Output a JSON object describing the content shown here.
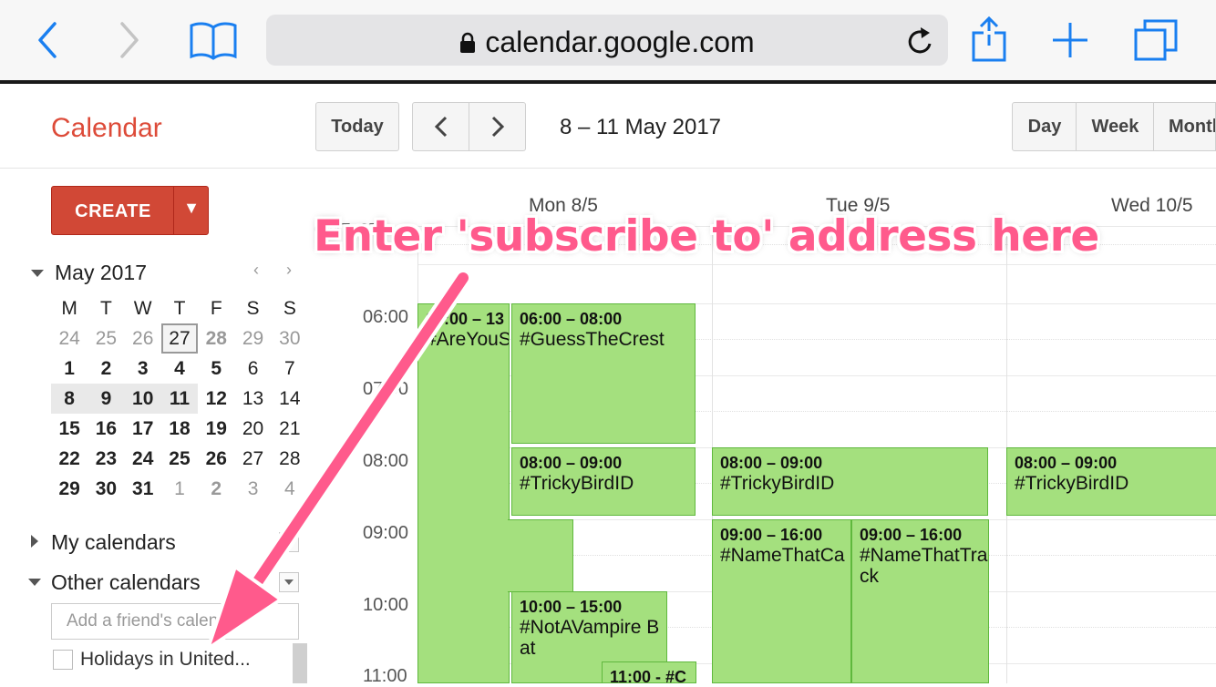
{
  "browser": {
    "url": "calendar.google.com",
    "icons": [
      "back-icon",
      "forward-icon",
      "bookmarks-icon",
      "lock-icon",
      "reload-icon",
      "share-icon",
      "new-tab-icon",
      "tabs-icon"
    ]
  },
  "header": {
    "app_title": "Calendar",
    "today_label": "Today",
    "date_range": "8 – 11 May 2017",
    "views": [
      "Day",
      "Week",
      "Month"
    ]
  },
  "sidebar": {
    "create_label": "CREATE",
    "mini_calendar": {
      "month": "May 2017",
      "weekdays": [
        "M",
        "T",
        "W",
        "T",
        "F",
        "S",
        "S"
      ],
      "weeks": [
        [
          "24",
          "25",
          "26",
          "27",
          "28",
          "29",
          "30"
        ],
        [
          "1",
          "2",
          "3",
          "4",
          "5",
          "6",
          "7"
        ],
        [
          "8",
          "9",
          "10",
          "11",
          "12",
          "13",
          "14"
        ],
        [
          "15",
          "16",
          "17",
          "18",
          "19",
          "20",
          "21"
        ],
        [
          "22",
          "23",
          "24",
          "25",
          "26",
          "27",
          "28"
        ],
        [
          "29",
          "30",
          "31",
          "1",
          "2",
          "3",
          "4"
        ]
      ]
    },
    "my_calendars_label": "My calendars",
    "other_calendars_label": "Other calendars",
    "friend_placeholder": "Add a friend's calendar",
    "holiday_calendar": "Holidays in United..."
  },
  "grid": {
    "timezone": "GMT+07",
    "days": [
      "Mon 8/5",
      "Tue 9/5",
      "Wed 10/5"
    ],
    "hours": [
      "06:00",
      "07:00",
      "08:00",
      "09:00",
      "10:00",
      "11:00"
    ],
    "events": [
      {
        "time": "06:00 – 13",
        "title": "#AreYouS"
      },
      {
        "time": "06:00 – 08:00",
        "title": "#GuessTheCrest"
      },
      {
        "time": "08:00 – 09:00",
        "title": "#TrickyBirdID"
      },
      {
        "time": "08:00 – 09:00",
        "title": "#TrickyBirdID"
      },
      {
        "time": "08:00 – 09:00",
        "title": "#TrickyBirdID"
      },
      {
        "time": "09:00 – 16:00",
        "title": "#NameThatCa"
      },
      {
        "time": "09:00 – 16:00",
        "title": "#NameThatTrack"
      },
      {
        "time": "10:00 – 15:00",
        "title": "#NotAVampire Bat"
      },
      {
        "time": "11:00 - #C",
        "title": ""
      }
    ]
  },
  "annotation": {
    "text": "Enter 'subscribe to' address here",
    "color": "#ff5a8c"
  }
}
